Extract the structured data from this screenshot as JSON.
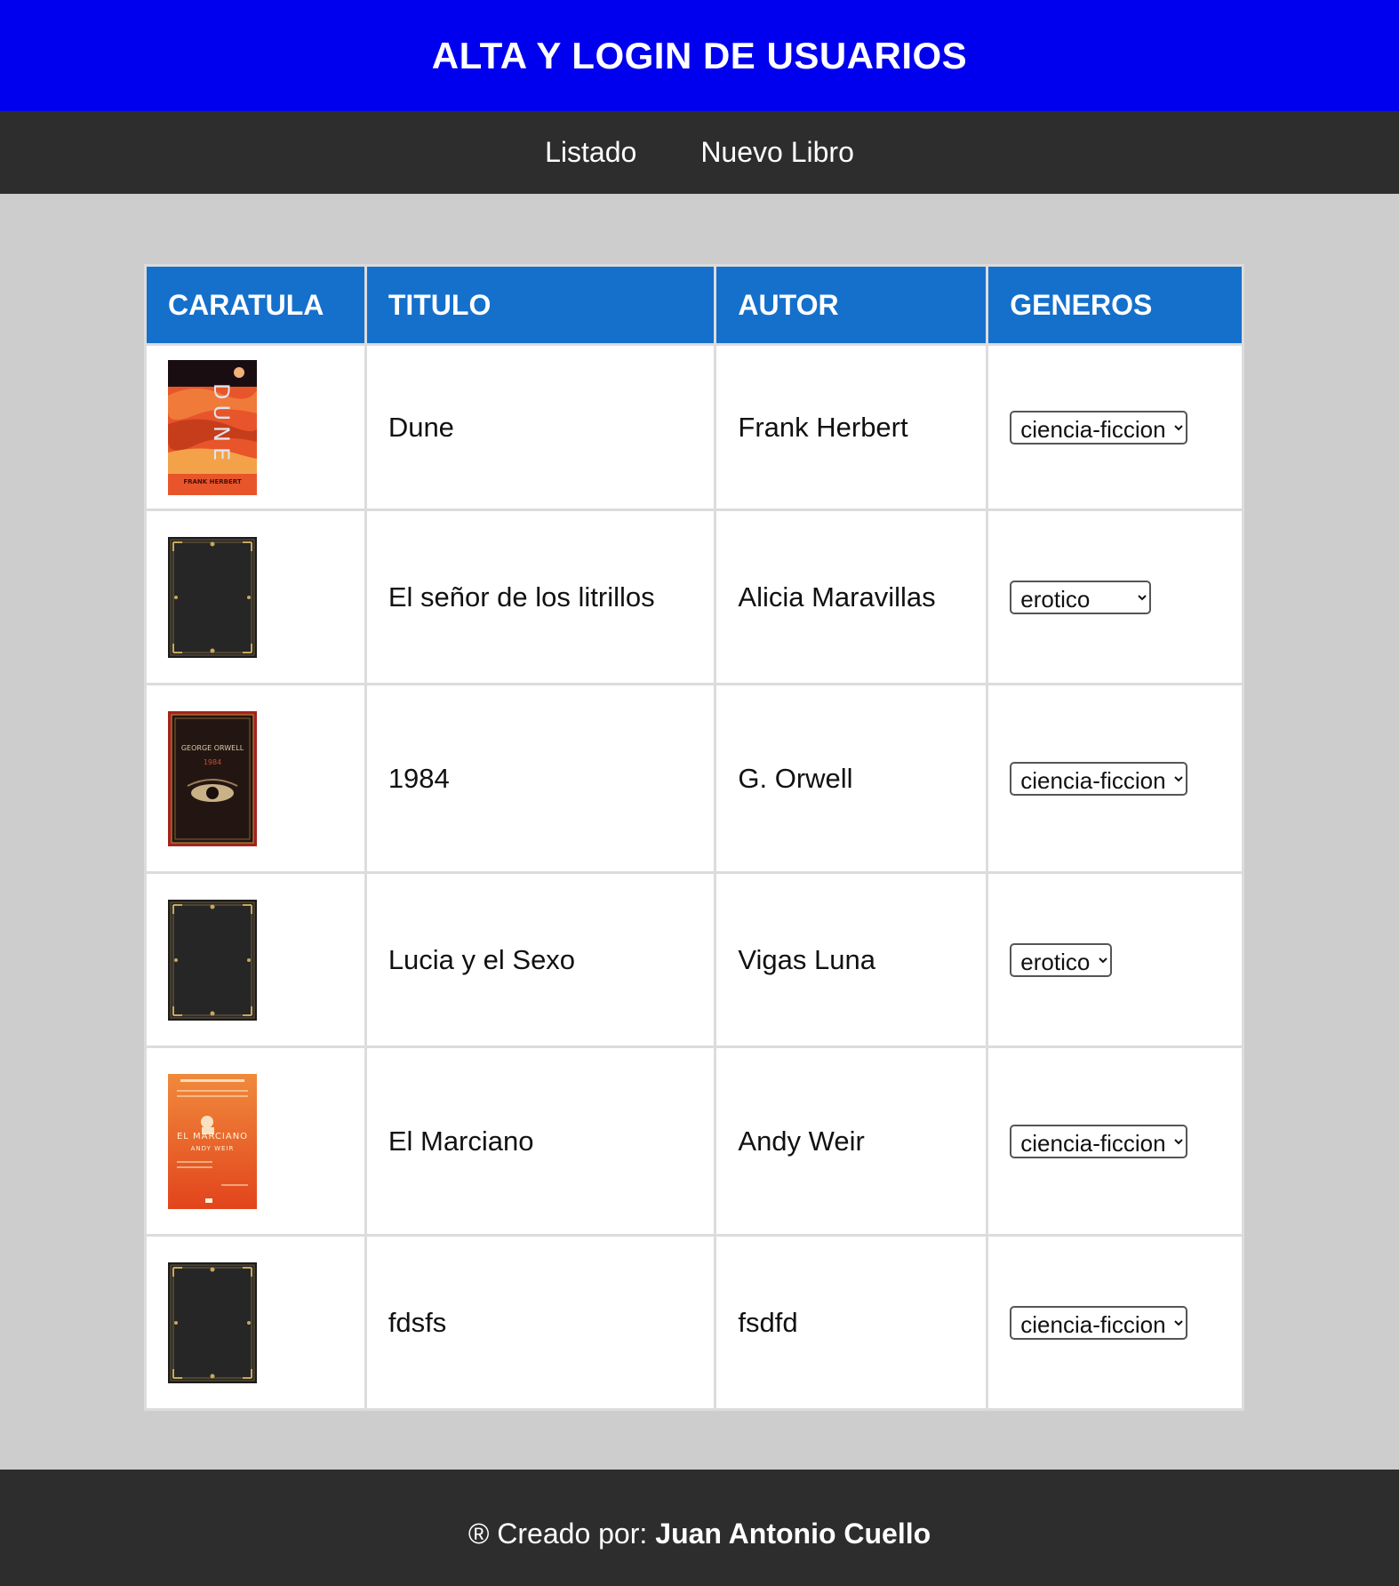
{
  "header": {
    "title": "ALTA Y LOGIN DE USUARIOS"
  },
  "nav": {
    "items": [
      {
        "label": "Listado"
      },
      {
        "label": "Nuevo Libro"
      }
    ]
  },
  "table": {
    "headers": [
      "CARATULA",
      "TITULO",
      "AUTOR",
      "GENEROS"
    ],
    "rows": [
      {
        "cover": "dune-cover",
        "title": "Dune",
        "author": "Frank Herbert",
        "genre": "ciencia-ficcion"
      },
      {
        "cover": "generic-leather-cover",
        "title": "El señor de los litrillos",
        "author": "Alicia Maravillas",
        "genre": "erotico"
      },
      {
        "cover": "1984-cover",
        "title": "1984",
        "author": "G. Orwell",
        "genre": "ciencia-ficcion"
      },
      {
        "cover": "generic-leather-cover",
        "title": "Lucia y el Sexo",
        "author": "Vigas Luna",
        "genre": "erotico"
      },
      {
        "cover": "el-marciano-cover",
        "title": "El Marciano",
        "author": "Andy Weir",
        "genre": "ciencia-ficcion"
      },
      {
        "cover": "generic-leather-cover",
        "title": "fdsfs",
        "author": "fsdfd",
        "genre": "ciencia-ficcion"
      }
    ],
    "cover_texts": {
      "dune": {
        "title": "DUNE",
        "author": "FRANK HERBERT"
      },
      "1984": {
        "author": "GEORGE ORWELL",
        "title": "1984"
      },
      "marciano": {
        "title": "EL MARCIANO",
        "author": "ANDY WEIR"
      }
    }
  },
  "footer": {
    "prefix": "® Creado por:",
    "author": "Juan Antonio Cuello"
  },
  "colors": {
    "header_bg": "#0000ee",
    "nav_bg": "#2d2d2d",
    "table_header_bg": "#1570cc",
    "page_bg": "#cdcdcd"
  }
}
